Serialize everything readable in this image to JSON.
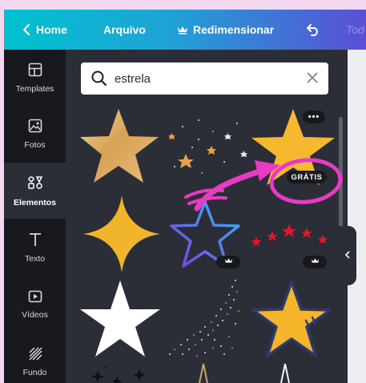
{
  "topbar": {
    "home_label": "Home",
    "file_label": "Arquivo",
    "resize_label": "Redimensionar",
    "faded_label": "Tod"
  },
  "sidebar": {
    "items": [
      {
        "label": "Templates",
        "icon": "templates-icon"
      },
      {
        "label": "Fotos",
        "icon": "photos-icon"
      },
      {
        "label": "Elementos",
        "icon": "elements-icon",
        "active": true
      },
      {
        "label": "Texto",
        "icon": "text-icon"
      },
      {
        "label": "Vídeos",
        "icon": "videos-icon"
      },
      {
        "label": "Fundo",
        "icon": "background-icon"
      }
    ]
  },
  "search": {
    "value": "estrela",
    "placeholder": ""
  },
  "results": {
    "free_badge": "GRÁTIS",
    "items": [
      {
        "name": "gold-foil-star",
        "badge": "none"
      },
      {
        "name": "scattered-small-stars",
        "badge": "none"
      },
      {
        "name": "yellow-star",
        "badge": "more"
      },
      {
        "name": "four-point-sparkle",
        "badge": "none"
      },
      {
        "name": "gradient-outline-star",
        "badge": "crown"
      },
      {
        "name": "red-stars-arc",
        "badge": "crown"
      },
      {
        "name": "white-star",
        "badge": "none"
      },
      {
        "name": "dotted-stars-swirl",
        "badge": "none"
      },
      {
        "name": "cartoon-yellow-star",
        "badge": "none"
      }
    ]
  },
  "colors": {
    "header_start": "#00c1cf",
    "header_end": "#5b4fd6",
    "rail_bg": "#17191f",
    "panel_bg": "#2b2e36",
    "annotation": "#e83bc4",
    "page_bg": "#f3d8ef"
  }
}
